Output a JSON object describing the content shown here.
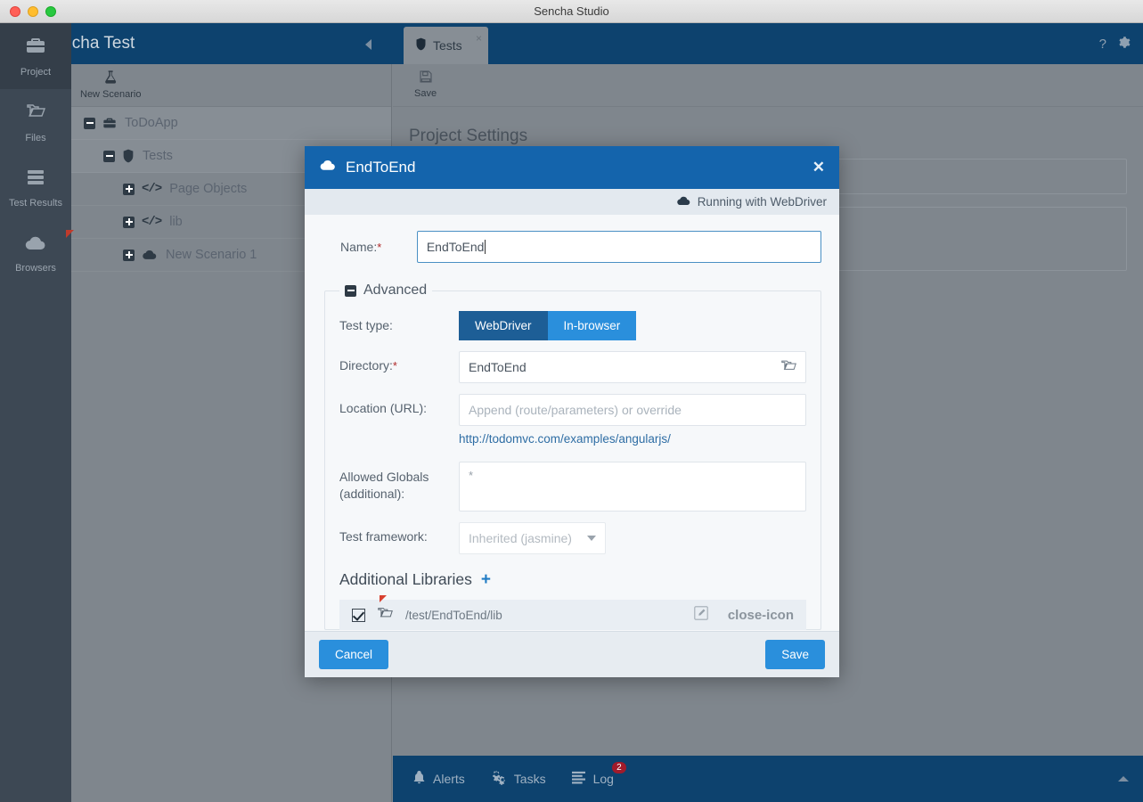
{
  "window": {
    "title": "Sencha Studio"
  },
  "header": {
    "brand": "Sencha Test",
    "help_icon": "question-mark-icon",
    "settings_icon": "gear-icon"
  },
  "rail": {
    "items": [
      {
        "label": "Project",
        "icon": "briefcase-icon",
        "active": true
      },
      {
        "label": "Files",
        "icon": "folder-icon",
        "active": false
      },
      {
        "label": "Test Results",
        "icon": "list-icon",
        "active": false
      },
      {
        "label": "Browsers",
        "icon": "cloud-icon",
        "active": false
      }
    ]
  },
  "sidebar": {
    "toolbar": {
      "new_scenario": "New Scenario",
      "icon": "flask-icon"
    },
    "tree": [
      {
        "label": "ToDoApp",
        "icon": "briefcase-icon",
        "indent": 0,
        "expanded": true,
        "selected": false
      },
      {
        "label": "Tests",
        "icon": "shield-icon",
        "indent": 1,
        "expanded": true,
        "selected": true
      },
      {
        "label": "Page Objects",
        "icon": "code-icon",
        "indent": 2,
        "expanded": false,
        "selected": false
      },
      {
        "label": "lib",
        "icon": "code-icon",
        "indent": 2,
        "expanded": false,
        "selected": false
      },
      {
        "label": "New Scenario 1",
        "icon": "cloud-icon",
        "indent": 2,
        "expanded": false,
        "selected": false
      }
    ]
  },
  "main": {
    "tab": {
      "label": "Tests",
      "icon": "shield-icon",
      "close": "×"
    },
    "toolbar": {
      "save_label": "Save",
      "save_icon": "floppy-disk-icon"
    },
    "content_title": "Project Settings"
  },
  "statusbar": {
    "alerts": "Alerts",
    "tasks": "Tasks",
    "log": "Log",
    "log_badge": "2"
  },
  "modal": {
    "title": "EndToEnd",
    "title_icon": "cloud-icon",
    "close": "✕",
    "subbar": {
      "text": "Running with WebDriver",
      "icon": "cloud-icon"
    },
    "name": {
      "label": "Name:",
      "required": "*",
      "value": "EndToEnd"
    },
    "advanced": {
      "legend": "Advanced",
      "test_type": {
        "label": "Test type:",
        "options": [
          "WebDriver",
          "In-browser"
        ],
        "selected": "WebDriver"
      },
      "directory": {
        "label": "Directory:",
        "required": "*",
        "value": "EndToEnd",
        "browse_icon": "folder-open-icon"
      },
      "location": {
        "label": "Location (URL):",
        "placeholder": "Append (route/parameters) or override",
        "value": "",
        "hint": "http://todomvc.com/examples/angularjs/"
      },
      "allowed_globals": {
        "label": "Allowed Globals (additional):",
        "value": "*"
      },
      "test_framework": {
        "label": "Test framework:",
        "value": "Inherited (jasmine)"
      },
      "libraries": {
        "title": "Additional Libraries",
        "add": "+",
        "rows": [
          {
            "checked": true,
            "path": "/test/EndToEnd/lib",
            "folder_icon": "folder-open-icon",
            "edit_icon": "pencil-icon",
            "remove_icon": "close-icon"
          }
        ]
      }
    },
    "footer": {
      "cancel": "Cancel",
      "save": "Save"
    }
  },
  "colors": {
    "header_blue": "#0d426e",
    "modal_blue": "#1464ac",
    "accent_blue": "#2a8fdc",
    "seg_selected": "#1d5e96",
    "badge_red": "#a01b2b",
    "rail_bg": "#3d4854",
    "overlay_gray": "#7f868d"
  }
}
